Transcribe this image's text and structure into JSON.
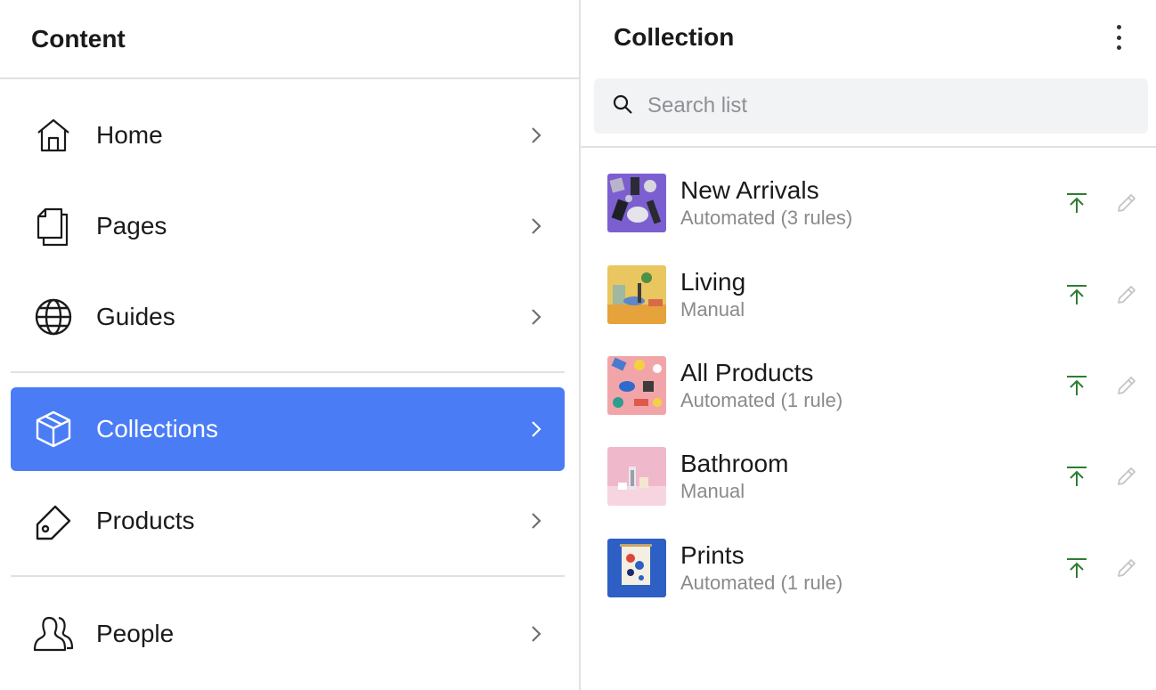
{
  "left_panel": {
    "title": "Content",
    "nav": [
      {
        "label": "Home",
        "icon": "home-icon"
      },
      {
        "label": "Pages",
        "icon": "pages-icon"
      },
      {
        "label": "Guides",
        "icon": "globe-icon"
      },
      {
        "label": "Collections",
        "icon": "collections-box-icon",
        "active": true
      },
      {
        "label": "Products",
        "icon": "tag-icon"
      },
      {
        "label": "People",
        "icon": "people-icon"
      }
    ]
  },
  "right_panel": {
    "title": "Collection",
    "search": {
      "placeholder": "Search list",
      "value": ""
    },
    "collections": [
      {
        "name": "New Arrivals",
        "type": "Automated (3 rules)"
      },
      {
        "name": "Living",
        "type": "Manual"
      },
      {
        "name": "All Products",
        "type": "Automated (1 rule)"
      },
      {
        "name": "Bathroom",
        "type": "Manual"
      },
      {
        "name": "Prints",
        "type": "Automated (1 rule)"
      }
    ]
  },
  "colors": {
    "active_nav": "#4a7cf6",
    "publish_icon": "#2e7d32",
    "divider": "#e1e1e1"
  }
}
